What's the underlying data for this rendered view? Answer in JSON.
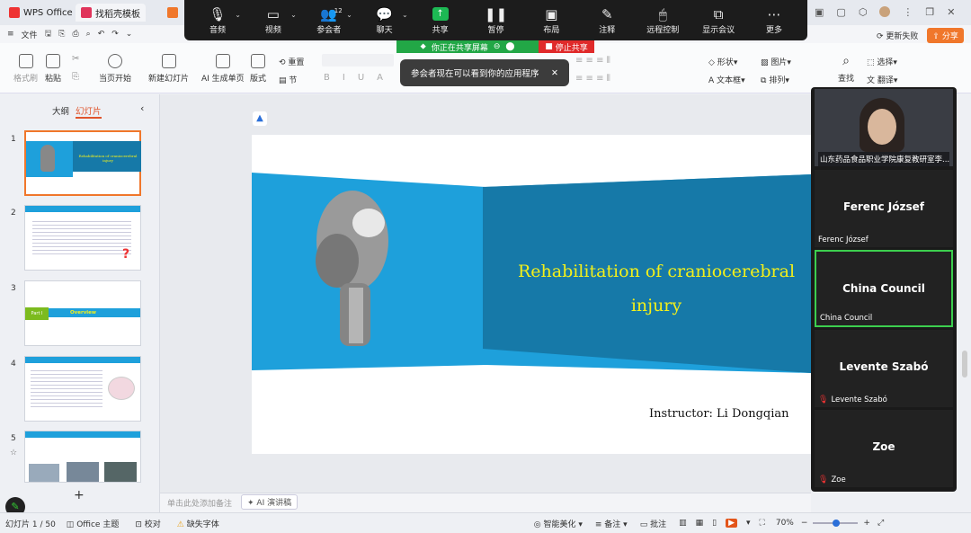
{
  "tabs": [
    {
      "label": "WPS Office"
    },
    {
      "label": "找稻壳模板"
    }
  ],
  "window": {
    "update_fail": "更新失败",
    "share_label": "分享"
  },
  "menu": {
    "file": "文件"
  },
  "meeting": {
    "buttons": [
      {
        "label": "音频",
        "icon": "mic-icon"
      },
      {
        "label": "视频",
        "icon": "camera-icon"
      },
      {
        "label": "参会者",
        "icon": "participants-icon",
        "count": "12"
      },
      {
        "label": "聊天",
        "icon": "chat-icon"
      },
      {
        "label": "共享",
        "icon": "share-screen-icon"
      },
      {
        "label": "暂停",
        "icon": "pause-icon"
      },
      {
        "label": "布局",
        "icon": "layout-icon"
      },
      {
        "label": "注释",
        "icon": "annotate-icon"
      },
      {
        "label": "远程控制",
        "icon": "mouse-icon"
      },
      {
        "label": "显示会议",
        "icon": "show-meeting-icon"
      },
      {
        "label": "更多",
        "icon": "more-icon"
      }
    ],
    "sharing_text": "你正在共享屏幕",
    "stop_share": "停止共享",
    "toast": "参会者现在可以看到你的应用程序"
  },
  "toolbar": {
    "format_painter": "格式刷",
    "paste": "粘贴",
    "from_current": "当页开始",
    "new_slide": "新建幻灯片",
    "ai_gen": "AI 生成单页",
    "layout": "版式",
    "reset": "重置",
    "section": "节",
    "shape": "形状",
    "image": "图片",
    "textbox": "文本框",
    "arrange": "排列",
    "find": "查找",
    "select": "选择",
    "translate": "翻译"
  },
  "leftpanel": {
    "tab_outline": "大纲",
    "tab_slides": "幻灯片",
    "slides": [
      "1",
      "2",
      "3",
      "4",
      "5"
    ],
    "thumb1_title": "Rehabilitation of craniocerebral injury",
    "thumb3_part": "Part I",
    "thumb3_overview": "Overview"
  },
  "slide": {
    "title_line1": "Rehabilitation of craniocerebral",
    "title_line2": "injury",
    "instructor": "Instructor: Li Dongqian"
  },
  "notes": {
    "placeholder": "单击此处添加备注",
    "ai_notes": "AI 演讲稿"
  },
  "participants": [
    {
      "name": "山东药品食品职业学院康复教研室李...",
      "video": true
    },
    {
      "name": "Ferenc József",
      "muted": false
    },
    {
      "name": "China Council",
      "muted": false,
      "active": true
    },
    {
      "name": "Levente Szabó",
      "muted": true
    },
    {
      "name": "Zoe",
      "muted": true
    }
  ],
  "status": {
    "slide_counter": "幻灯片 1 / 50",
    "theme": "Office 主题",
    "proof": "校对",
    "missing_font": "缺失字体",
    "beautify": "智能美化",
    "notes": "备注",
    "comment": "批注",
    "zoom": "70%"
  },
  "colors": {
    "accent_blue": "#1ea0db",
    "dark_blue": "#1679a8",
    "title_yellow": "#f3f01a",
    "wps_red": "#e33",
    "share_green": "#1db954"
  }
}
